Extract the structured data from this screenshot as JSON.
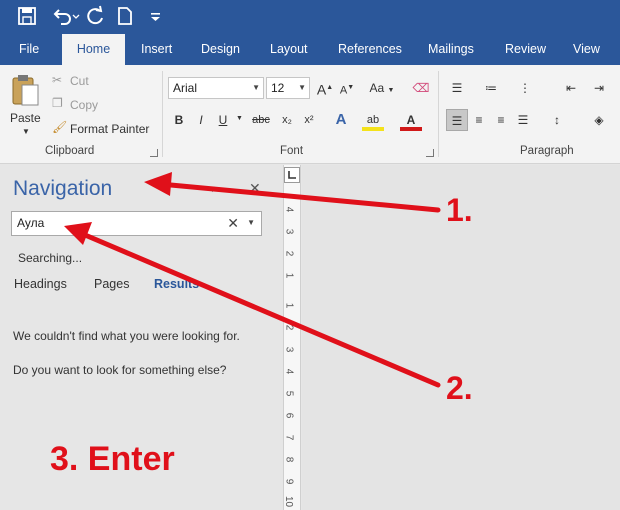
{
  "app": {
    "accent": "#2b579a",
    "quick_access": [
      {
        "icon": "save-icon"
      },
      {
        "icon": "undo-icon"
      },
      {
        "icon": "redo-icon"
      },
      {
        "icon": "new-document-icon"
      },
      {
        "icon": "customize-toolbar-icon"
      }
    ]
  },
  "tabs": [
    {
      "label": "File",
      "active": false
    },
    {
      "label": "Home",
      "active": true
    },
    {
      "label": "Insert",
      "active": false
    },
    {
      "label": "Design",
      "active": false
    },
    {
      "label": "Layout",
      "active": false
    },
    {
      "label": "References",
      "active": false
    },
    {
      "label": "Mailings",
      "active": false
    },
    {
      "label": "Review",
      "active": false
    },
    {
      "label": "View",
      "active": false
    }
  ],
  "ribbon": {
    "clipboard": {
      "label": "Clipboard",
      "paste": "Paste",
      "cut": "Cut",
      "copy": "Copy",
      "format_painter": "Format Painter"
    },
    "font": {
      "label": "Font",
      "family": "Arial",
      "size": "12",
      "bold": "B",
      "italic": "I",
      "underline": "U",
      "strikethrough": "abc",
      "subscript": "x₂",
      "superscript": "x²",
      "grow": "A",
      "shrink": "A",
      "change_case": "Aa"
    },
    "paragraph": {
      "label": "Paragraph"
    }
  },
  "navigation": {
    "title": "Navigation",
    "search_value": "Аула",
    "status": "Searching...",
    "tabs": [
      "Headings",
      "Pages",
      "Results"
    ],
    "active_tab": "Results",
    "message": "We couldn't find what you were looking for.",
    "suggestion": "Do you want to look for something else?"
  },
  "ruler": {
    "numbers": [
      "4",
      "3",
      "2",
      "1",
      "1",
      "2",
      "3",
      "4",
      "5",
      "6",
      "7",
      "8",
      "9",
      "10"
    ]
  },
  "annotations": {
    "label_1": "1.",
    "label_2": "2.",
    "label_3": "3. Enter",
    "color": "#e0101a"
  }
}
